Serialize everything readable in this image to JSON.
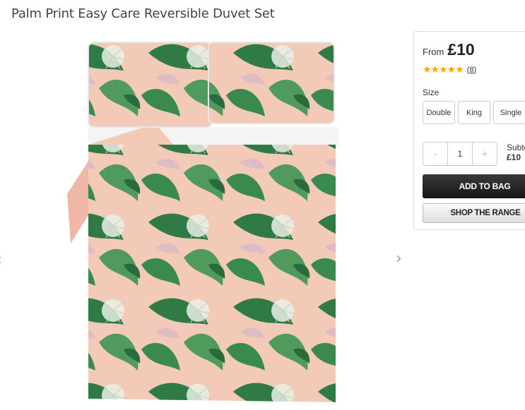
{
  "product": {
    "title": "Palm Print Easy Care Reversible Duvet Set"
  },
  "gallery": {
    "prev_icon": "‹",
    "next_icon": "›"
  },
  "purchase": {
    "from_label": "From",
    "price": "£10",
    "rating_stars": "★★★★★",
    "rating_value": 5,
    "review_count": "(8)",
    "size_label": "Size",
    "sizes": [
      "Double",
      "King",
      "Single"
    ],
    "qty_minus": "-",
    "qty_value": "1",
    "qty_plus": "+",
    "subtotal_label": "Subto",
    "subtotal_value": "£10",
    "add_to_bag": "ADD TO BAG",
    "shop_range": "SHOP THE RANGE"
  },
  "colors": {
    "star": "#f5a800",
    "button_dark": "#222222",
    "pink": "#f3c7b6",
    "leaf_dark": "#2f7a45",
    "leaf_mid": "#4f9a5c"
  }
}
